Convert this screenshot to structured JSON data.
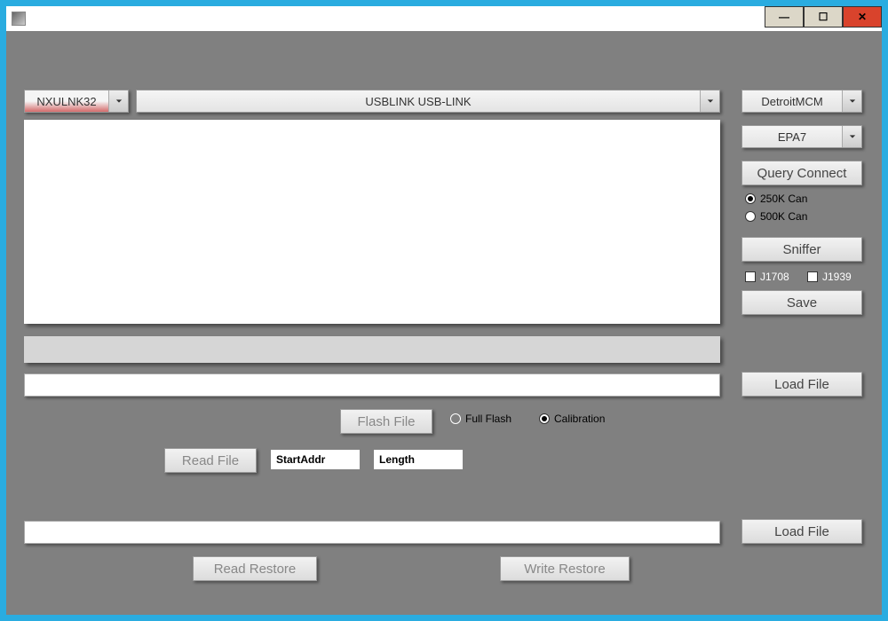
{
  "titlebar": {
    "title": ""
  },
  "win_controls": {
    "min": "—",
    "max": "☐",
    "close": "✕"
  },
  "adapter_dropdown": {
    "value": "NXULNK32"
  },
  "device_dropdown": {
    "value": "USBLINK USB-LINK"
  },
  "ecu_dropdown": {
    "value": "DetroitMCM"
  },
  "epa_dropdown": {
    "value": "EPA7"
  },
  "buttons": {
    "query_connect": "Query Connect",
    "sniffer": "Sniffer",
    "save": "Save",
    "load_file": "Load File",
    "load_file2": "Load File",
    "flash_file": "Flash File",
    "read_file": "Read File",
    "read_restore": "Read Restore",
    "write_restore": "Write Restore"
  },
  "radios": {
    "can250": "250K Can",
    "can500": "500K Can",
    "full_flash": "Full Flash",
    "calibration": "Calibration"
  },
  "checks": {
    "j1708": "J1708",
    "j1939": "J1939"
  },
  "fields": {
    "start_addr": "StartAddr",
    "length": "Length"
  }
}
